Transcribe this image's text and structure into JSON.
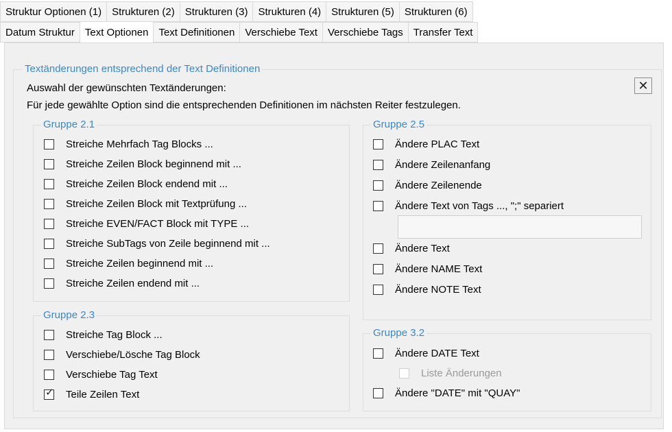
{
  "tabs_row1": [
    "Struktur Optionen (1)",
    "Strukturen (2)",
    "Strukturen (3)",
    "Strukturen (4)",
    "Strukturen (5)",
    "Strukturen (6)"
  ],
  "tabs_row2": [
    "Datum Struktur",
    "Text Optionen",
    "Text Definitionen",
    "Verschiebe Text",
    "Verschiebe Tags",
    "Transfer Text"
  ],
  "active_tab": "Text Optionen",
  "main_group": {
    "title": "Textänderungen entsprechend der Text Definitionen",
    "line1": "Auswahl der gewünschten Textänderungen:",
    "line2": "Für jede gewählte Option sind die entsprechenden Definitionen im nächsten Reiter festzulegen.",
    "close_icon": "close-icon"
  },
  "g21": {
    "title": "Gruppe 2.1",
    "items": [
      {
        "label": "Streiche Mehrfach Tag Blocks ...",
        "checked": false
      },
      {
        "label": "Streiche Zeilen Block beginnend mit ...",
        "checked": false
      },
      {
        "label": "Streiche Zeilen Block endend mit ...",
        "checked": false
      },
      {
        "label": "Streiche Zeilen Block mit Textprüfung ...",
        "checked": false
      },
      {
        "label": "Streiche EVEN/FACT Block mit TYPE ...",
        "checked": false
      },
      {
        "label": "Streiche SubTags von Zeile beginnend mit ...",
        "checked": false
      },
      {
        "label": "Streiche Zeilen beginnend mit ...",
        "checked": false
      },
      {
        "label": "Streiche Zeilen endend mit ...",
        "checked": false
      }
    ]
  },
  "g23": {
    "title": "Gruppe 2.3",
    "items": [
      {
        "label": "Streiche Tag Block ...",
        "checked": false
      },
      {
        "label": "Verschiebe/Lösche Tag Block",
        "checked": false
      },
      {
        "label": "Verschiebe Tag Text",
        "checked": false
      },
      {
        "label": "Teile Zeilen Text",
        "checked": true
      }
    ]
  },
  "g25": {
    "title": "Gruppe 2.5",
    "items": [
      {
        "label": "Ändere PLAC Text",
        "checked": false
      },
      {
        "label": "Ändere Zeilenanfang",
        "checked": false
      },
      {
        "label": "Ändere Zeilenende",
        "checked": false
      },
      {
        "label": "Ändere Text von Tags ..., \";\" separiert",
        "checked": false
      },
      {
        "label": "Ändere Text",
        "checked": false
      },
      {
        "label": "Ändere NAME Text",
        "checked": false
      },
      {
        "label": "Ändere NOTE Text",
        "checked": false
      }
    ],
    "tags_input_value": ""
  },
  "g32": {
    "title": "Gruppe 3.2",
    "items": [
      {
        "label": "Ändere DATE Text",
        "checked": false,
        "disabled": false
      },
      {
        "label": "Liste Änderungen",
        "checked": false,
        "disabled": true
      },
      {
        "label": "Ändere \"DATE\" mit \"QUAY\"",
        "checked": false,
        "disabled": false
      }
    ]
  }
}
